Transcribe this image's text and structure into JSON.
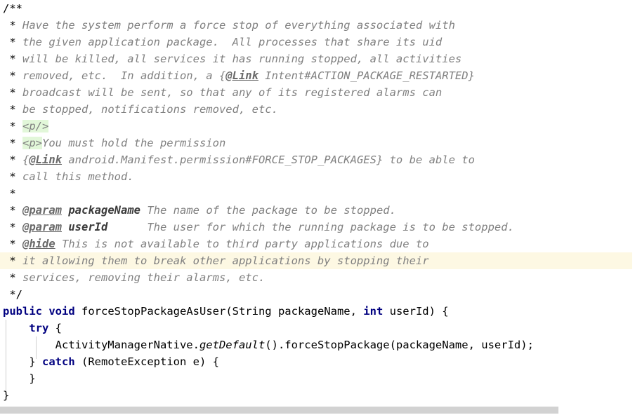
{
  "editor": {
    "language": "java",
    "colors": {
      "background": "#ffffff",
      "comment": "#808080",
      "keyword": "#000080",
      "code": "#000000",
      "current_line_highlight": "#fdf8e3",
      "html_tag_highlight": "#e2f7d9",
      "indent_guide": "#d0d0d0",
      "scrollbar_thumb": "#d2d2d2"
    },
    "caret": {
      "line_index": 17,
      "column": 56
    }
  },
  "lines": {
    "l0": "/**",
    "l1_a": " * ",
    "l1_b": "Have the system perform a force stop of everything associated with",
    "l2_a": " * ",
    "l2_b": "the given application package.  All processes that share its uid",
    "l3_a": " * ",
    "l3_b": "will be killed, all services it has running stopped, all activities",
    "l4_a": " * ",
    "l4_b": "removed, etc.  In addition, a {",
    "l4_link": "@Link",
    "l4_c": " Intent#ACTION_PACKAGE_RESTARTED}",
    "l5_a": " * ",
    "l5_b": "broadcast will be sent, so that any of its registered alarms can",
    "l6_a": " * ",
    "l6_b": "be stopped, notifications removed, etc.",
    "l7_a": " * ",
    "l7_tag": "<p/>",
    "l8_a": " * ",
    "l8_tag": "<p>",
    "l8_b": "You must hold the permission",
    "l9_a": " * ",
    "l9_b": "{",
    "l9_link": "@Link",
    "l9_c": " android.Manifest.permission#FORCE_STOP_PACKAGES} to be able to",
    "l10_a": " * ",
    "l10_b": "call this method.",
    "l11": " *",
    "l12_a": " * ",
    "l12_tag": "@param",
    "l12_sp": " ",
    "l12_val": "packageName",
    "l12_b": " The name of the package to be stopped.",
    "l13_a": " * ",
    "l13_tag": "@param",
    "l13_sp": " ",
    "l13_val": "userId",
    "l13_b": "      The user for which the running package is to be stopped.",
    "l14_a": " * ",
    "l14_tag": "@hide",
    "l14_b": " This is not available to third party applications due to",
    "l15_a": " * ",
    "l15_b": "it allowing them to break other applications by stopping their",
    "l16_a": " * ",
    "l16_b": "services, removing their alarms, etc.",
    "l17": " */",
    "l18_kw1": "public",
    "l18_sp1": " ",
    "l18_kw2": "void",
    "l18_sp2": " ",
    "l18_sig": "forceStopPackageAsUser(String packageName, ",
    "l18_kw3": "int",
    "l18_tail": " userId) {",
    "l19_ind": "    ",
    "l19_kw": "try",
    "l19_b": " {",
    "l20_ind": "        ",
    "l20_a": "ActivityManagerNative.",
    "l20_static": "getDefault",
    "l20_b": "().forceStopPackage(packageName, userId);",
    "l21_ind": "    ",
    "l21_a": "} ",
    "l21_kw": "catch",
    "l21_b": " (RemoteException e) {",
    "l22": "    }",
    "l23": "}"
  },
  "scrollbar": {
    "orientation": "horizontal",
    "thumb_left": 0,
    "thumb_width": 795,
    "track_width": 904
  }
}
